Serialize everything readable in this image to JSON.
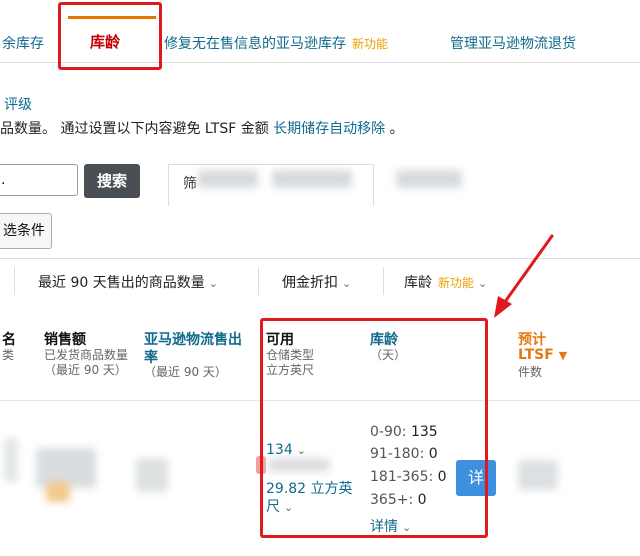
{
  "tabs": {
    "t0": "余库存",
    "t1": "库龄",
    "t2": "修复无在售信息的亚马逊库存",
    "t2_new": "新功能",
    "t3": "管理亚马逊物流退货"
  },
  "info": {
    "rating": "评级",
    "desc_prefix": "品数量。 通过设置以下内容避免 LTSF 金额",
    "desc_link": "长期储存自动移除",
    "desc_suffix": "。"
  },
  "search": {
    "button": "搜索",
    "filter_tab_label": "筛",
    "filter_conditions": "选条件"
  },
  "column_bar": {
    "c1": "最近 90 天售出的商品数量",
    "c2": "佣金折扣",
    "c3": "库龄",
    "c3_new": "新功能"
  },
  "table_head": {
    "name_title": "名",
    "name_sub": "类",
    "sales_title": "销售额",
    "sales_sub1": "已发货商品数量",
    "sales_sub2": "（最近 90 天）",
    "sellthrough_title1": "亚马逊物流售出",
    "sellthrough_title2": "率",
    "sellthrough_sub": "（最近 90 天）",
    "available_title": "可用",
    "available_sub1": "仓储类型",
    "available_sub2": "立方英尺",
    "age_title": "库龄",
    "age_sub": "（天）",
    "ltsf_title1": "预计",
    "ltsf_title2": "LTSF",
    "ltsf_sub": "件数"
  },
  "row": {
    "available_units": "134",
    "volume_line1": "29.82 立方英",
    "volume_line2": "尺",
    "age_ranges": [
      {
        "label": "0-90:",
        "value": "135"
      },
      {
        "label": "91-180:",
        "value": "0"
      },
      {
        "label": "181-365:",
        "value": "0"
      },
      {
        "label": "365+:",
        "value": "0"
      }
    ],
    "details": "详情",
    "detail_button": "详"
  },
  "colors": {
    "link": "#0f6a8c",
    "accent_orange": "#e77600",
    "active_tab_text": "#c40000",
    "new_feature": "#e8a100",
    "highlight_red": "#e0191f",
    "detail_button": "#3d8fe0"
  }
}
